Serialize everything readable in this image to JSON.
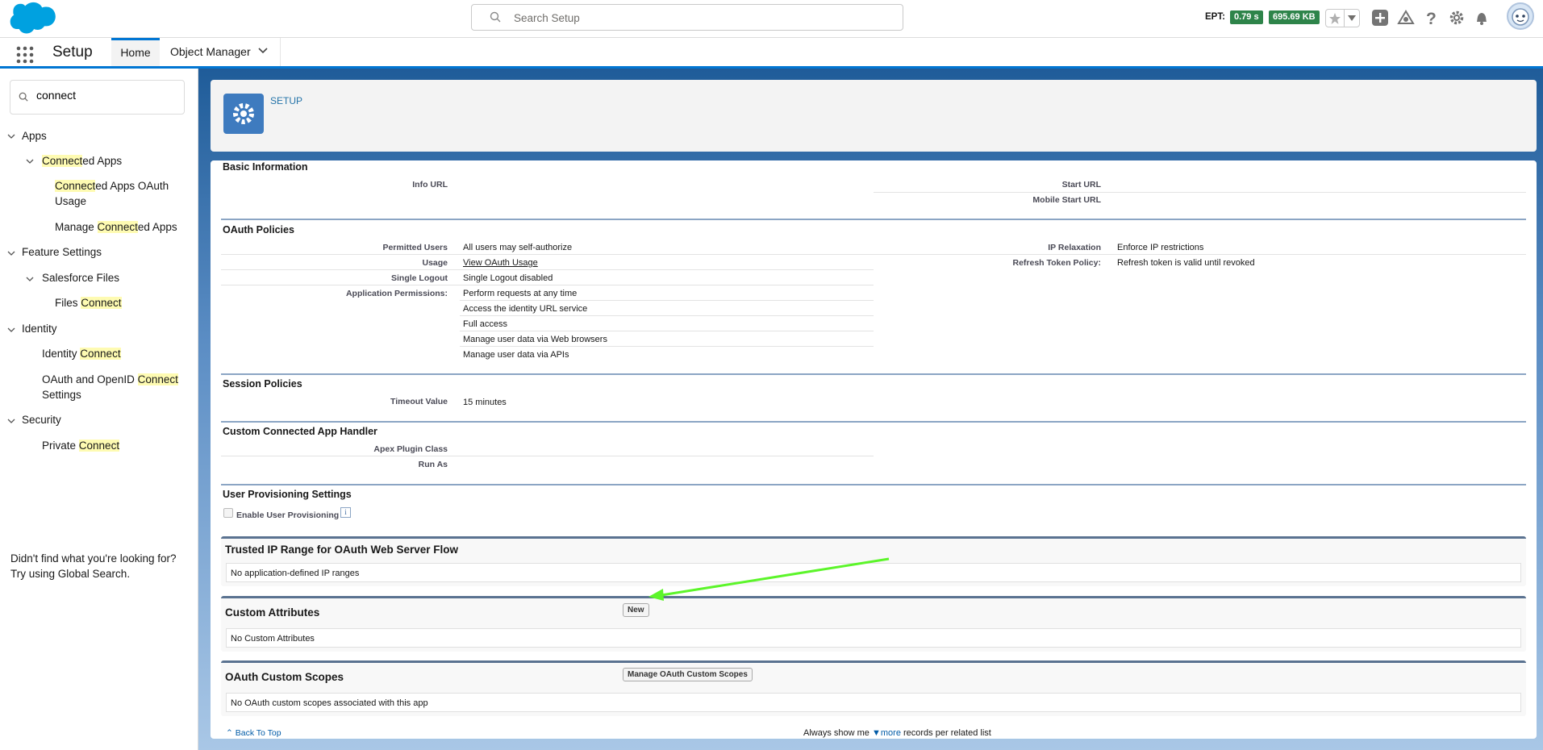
{
  "header": {
    "search_placeholder": "Search Setup",
    "ept_label": "EPT:",
    "ept_time": "0.79 s",
    "ept_size": "695.69 KB"
  },
  "nav": {
    "app_title": "Setup",
    "tabs": [
      {
        "label": "Home"
      },
      {
        "label": "Object Manager"
      }
    ]
  },
  "sidebar": {
    "quick_find_value": "connect",
    "tree": [
      {
        "label": "Apps"
      },
      {
        "pre": "",
        "hl": "Connect",
        "post": "ed Apps"
      },
      {
        "pre": "",
        "hl": "Connect",
        "post": "ed Apps OAuth"
      },
      {
        "pre": "Usage",
        "hl": "",
        "post": ""
      },
      {
        "pre": "Manage ",
        "hl": "Connect",
        "post": "ed Apps"
      },
      {
        "label": "Feature Settings"
      },
      {
        "label": "Salesforce Files"
      },
      {
        "pre": "Files ",
        "hl": "Connect",
        "post": ""
      },
      {
        "label": "Identity"
      },
      {
        "pre": "Identity ",
        "hl": "Connect",
        "post": ""
      },
      {
        "pre": "OAuth and OpenID ",
        "hl": "Connect",
        "post": ""
      },
      {
        "pre": "Settings",
        "hl": "",
        "post": ""
      },
      {
        "label": "Security"
      },
      {
        "pre": "Private ",
        "hl": "Connect",
        "post": ""
      }
    ],
    "not_found_line1": "Didn't find what you're looking for?",
    "not_found_line2": "Try using Global Search."
  },
  "setup_header": {
    "label": "SETUP"
  },
  "basic_info": {
    "title": "Basic Information",
    "info_url_label": "Info URL",
    "start_url_label": "Start URL",
    "mobile_start_url_label": "Mobile Start URL"
  },
  "oauth_policies": {
    "title": "OAuth Policies",
    "permitted_users_label": "Permitted Users",
    "permitted_users_value": "All users may self-authorize",
    "usage_label": "Usage",
    "usage_value": "View OAuth Usage",
    "single_logout_label": "Single Logout",
    "single_logout_value": "Single Logout disabled",
    "app_permissions_label": "Application Permissions:",
    "app_permissions": [
      "Perform requests at any time",
      "Access the identity URL service",
      "Full access",
      "Manage user data via Web browsers",
      "Manage user data via APIs"
    ],
    "ip_relaxation_label": "IP Relaxation",
    "ip_relaxation_value": "Enforce IP restrictions",
    "refresh_token_label": "Refresh Token Policy:",
    "refresh_token_value": "Refresh token is valid until revoked"
  },
  "session_policies": {
    "title": "Session Policies",
    "timeout_label": "Timeout Value",
    "timeout_value": "15 minutes"
  },
  "handler": {
    "title": "Custom Connected App Handler",
    "apex_label": "Apex Plugin Class",
    "run_as_label": "Run As"
  },
  "provisioning": {
    "title": "User Provisioning Settings",
    "checkbox_label": "Enable User Provisioning",
    "info_icon": "i"
  },
  "trusted_ip": {
    "title": "Trusted IP Range for OAuth Web Server Flow",
    "body": "No application-defined IP ranges"
  },
  "custom_attributes": {
    "title": "Custom Attributes",
    "button": "New",
    "body": "No Custom Attributes"
  },
  "oauth_scopes": {
    "title": "OAuth Custom Scopes",
    "button": "Manage OAuth Custom Scopes",
    "body": "No OAuth custom scopes associated with this app"
  },
  "footer": {
    "back_to_top": "Back To Top",
    "always_show": "Always show me",
    "more": "more",
    "records_per": "records per related list"
  },
  "colors": {
    "accent": "#0176d3",
    "highlight": "#fefbb2",
    "arrow": "#5cf52a"
  }
}
